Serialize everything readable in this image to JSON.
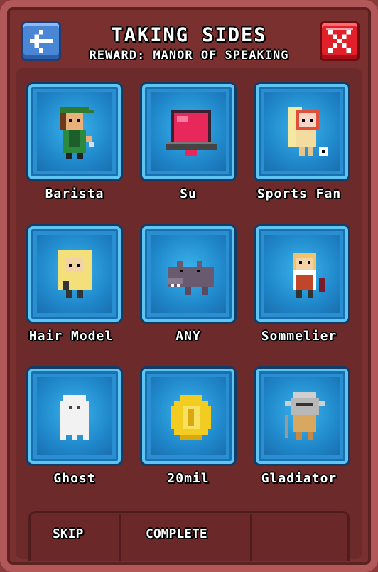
{
  "header": {
    "title": "TAKING SIDES",
    "reward": "REWARD: MANOR OF SPEAKING"
  },
  "buttons": {
    "back_icon": "arrow-left-icon",
    "close_icon": "close-x-icon"
  },
  "colors": {
    "back": "#4a86d6",
    "close": "#e2202a",
    "cell": "#2a8fd0",
    "panel": "#7b3030"
  },
  "options": [
    {
      "label": "Barista",
      "icon": "barista-icon"
    },
    {
      "label": "Su",
      "icon": "su-bucks-icon"
    },
    {
      "label": "Sports Fan",
      "icon": "sports-fan-icon"
    },
    {
      "label": "Hair Model",
      "icon": "hair-model-icon"
    },
    {
      "label": "ANY",
      "icon": "hippo-icon"
    },
    {
      "label": "Sommelier",
      "icon": "sommelier-icon"
    },
    {
      "label": "Ghost",
      "icon": "ghost-icon"
    },
    {
      "label": "20mil",
      "icon": "gold-coin-icon"
    },
    {
      "label": "Gladiator",
      "icon": "gladiator-icon"
    }
  ],
  "footer": {
    "skip": "SKIP",
    "complete": "COMPLETE"
  }
}
